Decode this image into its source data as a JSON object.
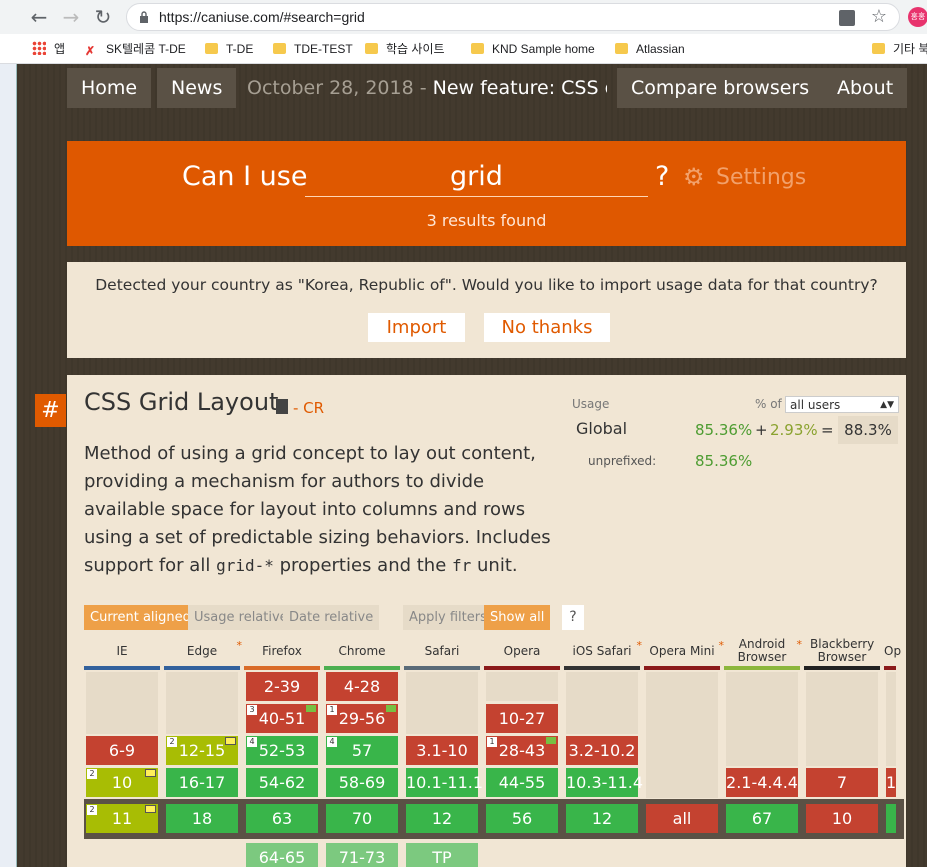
{
  "browser": {
    "url": "https://caniuse.com/#search=grid",
    "profile_label": "홍홍",
    "bookmarks": [
      "앱",
      "SK텔레콤 T-DE",
      "T-DE",
      "TDE-TEST",
      "학습 사이트",
      "KND Sample home",
      "Atlassian",
      "기타 북"
    ]
  },
  "nav": {
    "home": "Home",
    "news": "News",
    "news_date": "October 28, 2018",
    "news_sep": " - ",
    "news_title": "New feature: CSS overfl...",
    "compare": "Compare browsers",
    "about": "About"
  },
  "search": {
    "prefix": "Can I use",
    "query": "grid",
    "suffix": "?",
    "settings": "Settings",
    "results": "3 results found"
  },
  "country": {
    "message": "Detected your country as \"Korea, Republic of\". Would you like to import usage data for that country?",
    "import": "Import",
    "no_thanks": "No thanks"
  },
  "feature": {
    "hash": "#",
    "title": "CSS Grid Layout",
    "status": "- CR",
    "desc_1": "Method of using a grid concept to lay out content, providing a mechanism for authors to divide available space for layout into columns and rows using a set of predictable sizing behaviors. Includes support for all ",
    "desc_code1": "grid-*",
    "desc_2": " properties and the ",
    "desc_code2": "fr",
    "desc_3": " unit.",
    "usage_label": "Usage",
    "pct_of": "% of",
    "users_option": "all users",
    "global_label": "Global",
    "global_full": "85.36%",
    "plus": "+",
    "global_partial": "2.93%",
    "equals": "=",
    "global_total": "88.3%",
    "unprefixed_label": "unprefixed:",
    "unprefixed_val": "85.36%"
  },
  "tabs": {
    "current_aligned": "Current aligned",
    "usage_relative": "Usage relative",
    "date_relative": "Date relative",
    "apply_filters": "Apply filters",
    "show_all": "Show all",
    "help": "?"
  },
  "colors": {
    "supported": "#39b54a",
    "unsupported": "#c44230",
    "partial": "#a8bd04",
    "accent": "#e05a00"
  },
  "browsers": [
    {
      "name": "IE",
      "bar": "#33619c",
      "star": ""
    },
    {
      "name": "Edge",
      "bar": "#33619c",
      "star": "*"
    },
    {
      "name": "Firefox",
      "bar": "#d96b28",
      "star": ""
    },
    {
      "name": "Chrome",
      "bar": "#4caf50",
      "star": ""
    },
    {
      "name": "Safari",
      "bar": "#5a6b78",
      "star": ""
    },
    {
      "name": "Opera",
      "bar": "#8b1a1a",
      "star": ""
    },
    {
      "name": "iOS Safari",
      "bar": "#333333",
      "star": "*"
    },
    {
      "name": "Opera Mini",
      "bar": "#8b1a1a",
      "star": "*"
    },
    {
      "name": "Android Browser",
      "bar": "#8cb63c",
      "star": "*"
    },
    {
      "name": "Blackberry Browser",
      "bar": "#222222",
      "star": ""
    },
    {
      "name": "Op",
      "bar": "#8b1a1a",
      "star": ""
    }
  ],
  "support": {
    "ie": [
      "6-9",
      "10",
      "11"
    ],
    "edge": [
      "12-15",
      "16-17",
      "18"
    ],
    "firefox": [
      "2-39",
      "40-51",
      "52-53",
      "54-62",
      "63",
      "64-65"
    ],
    "chrome": [
      "4-28",
      "29-56",
      "57",
      "58-69",
      "70",
      "71-73"
    ],
    "safari": [
      "3.1-10",
      "10.1-11.1",
      "12",
      "TP"
    ],
    "opera": [
      "10-27",
      "28-43",
      "44-55",
      "56"
    ],
    "ios": [
      "3.2-10.2",
      "10.3-11.4",
      "12"
    ],
    "opmini": [
      "all"
    ],
    "android": [
      "2.1-4.4.4",
      "67"
    ],
    "blackberry": [
      "7",
      "10"
    ],
    "opmobile": [
      "1"
    ],
    "notes": {
      "two": "2",
      "three": "3",
      "one": "1",
      "four": "4"
    }
  }
}
